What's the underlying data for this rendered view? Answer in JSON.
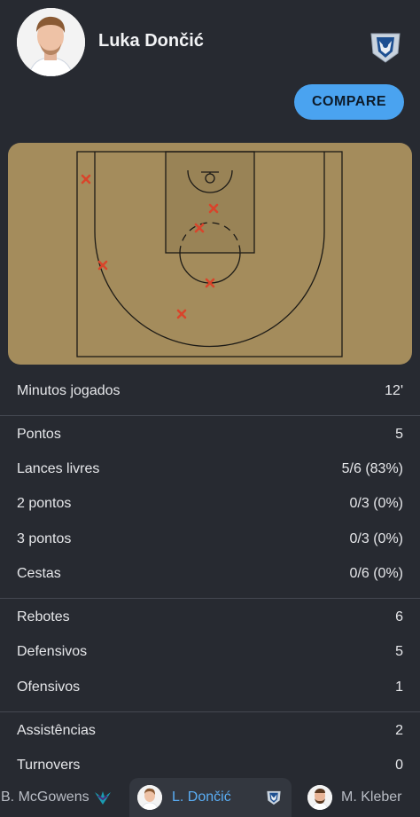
{
  "player": {
    "name": "Luka Dončić",
    "team_logo_icon": "mavericks-logo-icon"
  },
  "compare_label": "COMPARE",
  "court": {
    "description_icon": "shot-chart-court",
    "miss_color": "#d9442b",
    "shots": [
      {
        "result": "miss"
      },
      {
        "result": "miss"
      },
      {
        "result": "miss"
      },
      {
        "result": "miss"
      },
      {
        "result": "miss"
      },
      {
        "result": "miss"
      }
    ]
  },
  "stats": {
    "minutes": {
      "label": "Minutos jogados",
      "value": "12'"
    },
    "points": {
      "label": "Pontos",
      "value": "5"
    },
    "free_throws": {
      "label": "Lances livres",
      "value": "5/6 (83%)"
    },
    "two_points": {
      "label": "2 pontos",
      "value": "0/3 (0%)"
    },
    "three_points": {
      "label": "3 pontos",
      "value": "0/3 (0%)"
    },
    "field_goals": {
      "label": "Cestas",
      "value": "0/6 (0%)"
    },
    "rebounds": {
      "label": "Rebotes",
      "value": "6"
    },
    "defensive": {
      "label": "Defensivos",
      "value": "5"
    },
    "offensive": {
      "label": "Ofensivos",
      "value": "1"
    },
    "assists": {
      "label": "Assistências",
      "value": "2"
    },
    "turnovers": {
      "label": "Turnovers",
      "value": "0"
    }
  },
  "bottom_tabs": [
    {
      "label": "B. McGowens",
      "icon": "hornets-logo-icon"
    },
    {
      "label": "L. Dončić",
      "icon": "mavericks-logo-icon"
    },
    {
      "label": "M. Kleber",
      "icon": "player-avatar"
    }
  ],
  "colors": {
    "background": "#272a31",
    "accent": "#4aa3f0",
    "court": "#a48c5c",
    "active_tab_text": "#5aaef5"
  }
}
